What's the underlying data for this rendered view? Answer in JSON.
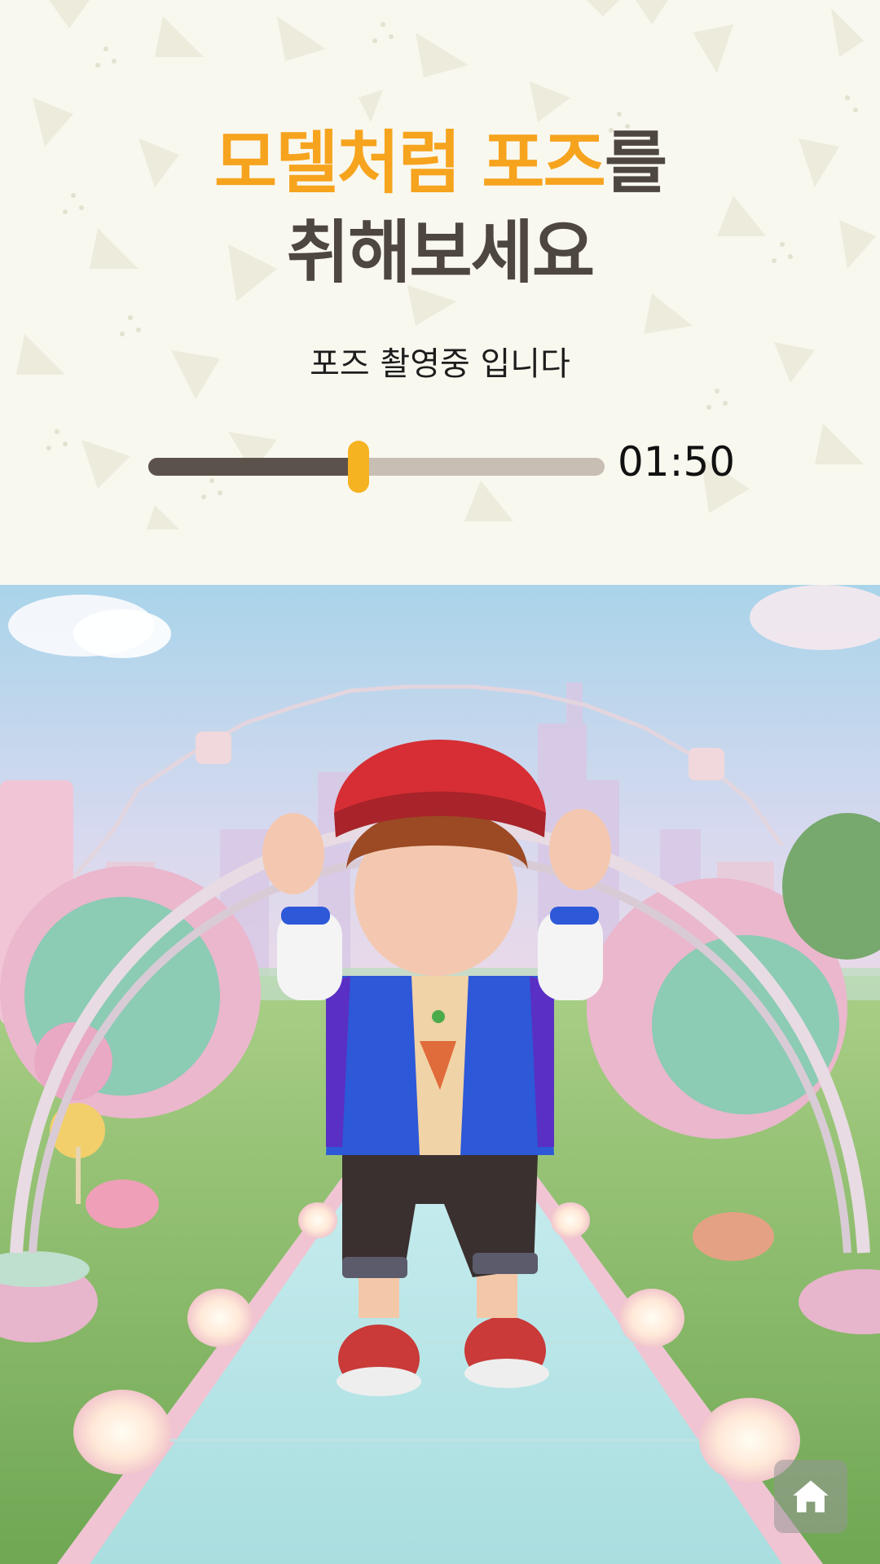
{
  "header": {
    "title_highlight_1": "모델처럼",
    "title_highlight_2": "포즈",
    "title_rest_1": "를",
    "title_line_2": "취해보세요",
    "subtitle": "포즈 촬영중 입니다"
  },
  "progress": {
    "fraction": 0.46,
    "time_label": "01:50"
  },
  "icons": {
    "home": "home-icon"
  },
  "colors": {
    "accent": "#f6a31e",
    "title": "#4e4640",
    "thumb": "#f5b321",
    "track_filled": "#5b524c",
    "track_empty": "#c8beb4",
    "background": "#f9f8ef"
  }
}
